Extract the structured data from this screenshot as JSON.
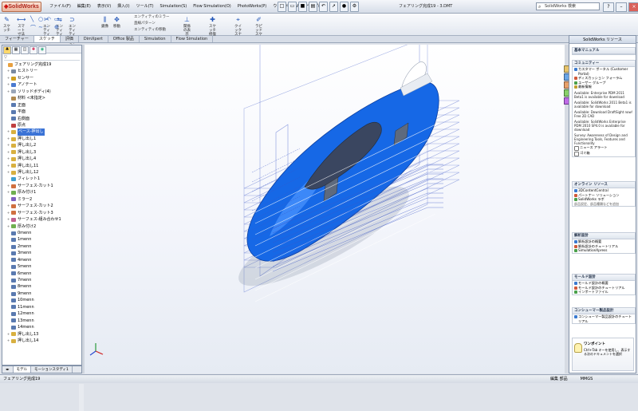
{
  "app": {
    "logo_text": "SolidWorks",
    "document_title": "フェアリング完成19 - 3.DMT",
    "menus": [
      "ファイル(F)",
      "編集(E)",
      "表示(V)",
      "挿入(I)",
      "ツール(T)",
      "Simulation(S)",
      "Flow Simulation(O)",
      "PhotoWorks(P)",
      "ウィンドウ(W)",
      "ヘルプ(H)"
    ],
    "search_placeholder": "SolidWorks 検索"
  },
  "ribbon": {
    "buttons": [
      {
        "label": "スケッチ",
        "icon": "pencil-icon"
      },
      {
        "label": "スマート寸法",
        "icon": "dimension-icon"
      },
      {
        "label": "エンティティのトリム",
        "icon": "trim-icon"
      },
      {
        "label": "エンティティ変換",
        "icon": "convert-icon"
      },
      {
        "label": "エンティティオフセット",
        "icon": "offset-icon"
      },
      {
        "label": "鏡像",
        "icon": "mirror-icon"
      },
      {
        "label": "移動",
        "icon": "move-icon"
      },
      {
        "label": "関係の表示",
        "icon": "relation-icon"
      },
      {
        "label": "スケッチ修復",
        "icon": "repair-icon"
      },
      {
        "label": "クイックスナップ",
        "icon": "snap-icon"
      },
      {
        "label": "ラピッドスケッチ",
        "icon": "rapid-icon"
      }
    ],
    "small_items": [
      "エンティティのミラー",
      "直線パターン",
      "エンティティの移動"
    ]
  },
  "command_tabs": [
    "フィーチャー",
    "スケッチ",
    "評価",
    "DimXpert",
    "Office 製品",
    "Simulation",
    "Flow Simulation"
  ],
  "feature_tree": {
    "filter": "▽",
    "items": [
      {
        "label": "フェアリング完成19",
        "icon": "part-icon",
        "expand": ""
      },
      {
        "label": "ヒストリー",
        "icon": "history-icon",
        "expand": "+"
      },
      {
        "label": "センサー",
        "icon": "sensor-icon",
        "expand": "+"
      },
      {
        "label": "アノテート",
        "icon": "annotation-icon",
        "expand": "+"
      },
      {
        "label": "ソリッドボディ(4)",
        "icon": "body-icon",
        "expand": "+"
      },
      {
        "label": "材料 <未指定>",
        "icon": "material-icon",
        "expand": ""
      },
      {
        "label": "正面",
        "icon": "plane-icon",
        "expand": ""
      },
      {
        "label": "平面",
        "icon": "plane-icon",
        "expand": ""
      },
      {
        "label": "右側面",
        "icon": "plane-icon",
        "expand": ""
      },
      {
        "label": "原点",
        "icon": "origin-icon",
        "expand": ""
      },
      {
        "label": "ベース-押出し",
        "icon": "extrude-icon",
        "expand": "+",
        "selected": true
      },
      {
        "label": "押し出し1",
        "icon": "extrude-icon",
        "expand": "+"
      },
      {
        "label": "押し出し2",
        "icon": "extrude-icon",
        "expand": "+"
      },
      {
        "label": "押し出し3",
        "icon": "extrude-icon",
        "expand": "+"
      },
      {
        "label": "押し出し4",
        "icon": "extrude-icon",
        "expand": "+"
      },
      {
        "label": "押し出し11",
        "icon": "extrude-icon",
        "expand": "+"
      },
      {
        "label": "押し出し12",
        "icon": "extrude-icon",
        "expand": "+"
      },
      {
        "label": "フィレット1",
        "icon": "fillet-icon",
        "expand": ""
      },
      {
        "label": "サーフェス-カット1",
        "icon": "cut-icon",
        "expand": "+"
      },
      {
        "label": "厚み付け1",
        "icon": "thicken-icon",
        "expand": "+"
      },
      {
        "label": "ミラー2",
        "icon": "mirror-icon",
        "expand": ""
      },
      {
        "label": "サーフェス-カット2",
        "icon": "cut-icon",
        "expand": "+"
      },
      {
        "label": "サーフェス-カット3",
        "icon": "cut-icon",
        "expand": "+"
      },
      {
        "label": "サーフェス-組み合わせ1",
        "icon": "knit-icon",
        "expand": "+"
      },
      {
        "label": "厚み付け2",
        "icon": "thicken-icon",
        "expand": "+"
      },
      {
        "label": "0menn",
        "icon": "plane-icon",
        "expand": ""
      },
      {
        "label": "1menn",
        "icon": "plane-icon",
        "expand": ""
      },
      {
        "label": "2menn",
        "icon": "plane-icon",
        "expand": ""
      },
      {
        "label": "3menn",
        "icon": "plane-icon",
        "expand": ""
      },
      {
        "label": "4menn",
        "icon": "plane-icon",
        "expand": ""
      },
      {
        "label": "5menn",
        "icon": "plane-icon",
        "expand": ""
      },
      {
        "label": "6menn",
        "icon": "plane-icon",
        "expand": ""
      },
      {
        "label": "7menn",
        "icon": "plane-icon",
        "expand": ""
      },
      {
        "label": "8menn",
        "icon": "plane-icon",
        "expand": ""
      },
      {
        "label": "9menn",
        "icon": "plane-icon",
        "expand": ""
      },
      {
        "label": "10menn",
        "icon": "plane-icon",
        "expand": ""
      },
      {
        "label": "11menn",
        "icon": "plane-icon",
        "expand": ""
      },
      {
        "label": "12menn",
        "icon": "plane-icon",
        "expand": ""
      },
      {
        "label": "13menn",
        "icon": "plane-icon",
        "expand": ""
      },
      {
        "label": "14menn",
        "icon": "plane-icon",
        "expand": ""
      },
      {
        "label": "押し出し13",
        "icon": "extrude-icon",
        "expand": "+"
      },
      {
        "label": "押し出し14",
        "icon": "extrude-icon",
        "expand": "+"
      }
    ],
    "bottom_tabs": [
      "モデル",
      "モーションスタディ1"
    ]
  },
  "task_pane": {
    "header": "SolidWorks リソース",
    "sections": [
      {
        "title": "基本マニュアル",
        "items": []
      },
      {
        "title": "コミュニティー",
        "items": [
          "カスタマー ポータル (Customer Portal)",
          "ディスカッション フォーラム",
          "ユーザー グループ",
          "最新情報"
        ],
        "news": [
          "Available: Enterprise PDM 2011 Beta1 is available for download",
          "Available: SolidWorks 2011 Beta1 is available for download",
          "Available: Download DraftSight now! Free 2D CAD",
          "Available: SolidWorks Enterprise PDM 2010 SP4.0 is available for download",
          "Survey: Awareness of Design and Engineering Tools, Features and Functionality"
        ],
        "extra": [
          "ニュース アラート",
          "ゴミ箱"
        ]
      },
      {
        "title": "オンライン リソース",
        "items": [
          "3DContentCentral",
          "パートナー ソリューション",
          "SolidWorks ラボ"
        ],
        "note": "部品設定、部品種類などを追加"
      },
      {
        "title": "解析設計",
        "items": [
          "解析設計の概要",
          "解析設計のチュートリアル",
          "SimulationXpress"
        ]
      },
      {
        "title": "モールド設計",
        "items": [
          "モールド設計の概要",
          "モールド設計のチュートリアル",
          "インポートファイル"
        ]
      },
      {
        "title": "コンシューマー製品設計",
        "items": [
          "コンシューマー製品設計のチュートリアル"
        ]
      }
    ],
    "tip_title": "ワンポイント",
    "tip_text": "Ctrl+Tab キーを使用し、表示する次のドキュメントを選択"
  },
  "status": {
    "left": "フェアリング完成19",
    "right": [
      "編集 部品",
      "MMGS"
    ]
  },
  "colors": {
    "model_blue": "#1668e6",
    "plane_blue": "#3a56c8",
    "selection": "#3b73d6"
  }
}
